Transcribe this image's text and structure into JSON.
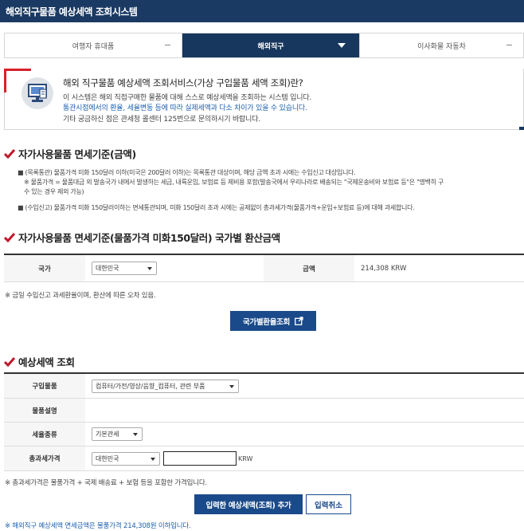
{
  "header": {
    "title": "해외직구물품 예상세액 조회시스템"
  },
  "tabs": [
    {
      "label": "여행자 휴대품"
    },
    {
      "label": "해외직구"
    },
    {
      "label": "이사화물 자동차"
    }
  ],
  "info": {
    "heading": "해외 직구물품 예상세액 조회서비스(가상 구입물품 세액 조회)란?",
    "line1": "이 시스템은 해외 직접구매한 물품에 대해 스스로 예상세액을 조회하는 시스템 입니다.",
    "line2": "통관시점에서의 환율, 세율변동 등에 따라 실제세액과 다소 차이가 있을 수 있습니다.",
    "line3": "기타 궁금하신 점은 관세청 콜센터 125번으로 문의하시기 바랍니다."
  },
  "section1": {
    "title": "자가사용물품 면세기준(금액)",
    "b1": "(목록통관) 물품가격 미화 150달러 이하(미국은 200달러 이하)는 목록통관 대상이며, 해당 금액 초과 시에는 수입신고 대상입니다.",
    "b1_note1": "※ 물품가격 = 물품대금 외 발송국가 내에서 발생하는 세금, 내륙운임, 보험료 등 제비용 포함(발송국에서 우리나라로 배송되는 \"국제운송비와 보험료 등\"은 \"명백히 구",
    "b1_note2": "수 있는 경우 제외 가능)",
    "b2": "(수입신고) 물품가격 미화 150달러이하는 면세통관되며, 미화 150달러 초과 시에는 공제없이 총과세가격(물품가격+운임+보험료 등)에 대해 과세합니다."
  },
  "section2": {
    "title": "자가사용물품 면세기준(물품가격 미화150달러) 국가별 환산금액",
    "country_label": "국가",
    "country_value": "대한민국",
    "amount_label": "금액",
    "amount_value": "214,308 KRW",
    "note": "※ 금일 수입신고 과세환율이며, 환산에 따른 오차 있음.",
    "button": "국가별환율조회"
  },
  "section3": {
    "title": "예상세액 조회",
    "item_label": "구입물품",
    "item_value": "컴퓨터/가전/영상/음향_컴퓨터, 관련 부품",
    "desc_label": "물품설명",
    "tax_label": "세율종류",
    "tax_value": "기본관세",
    "price_label": "총과세가격",
    "price_country": "대한민국",
    "price_value": "",
    "price_unit": "KRW",
    "note": "※ 총과세가격은 물품가격 + 국제 배송료 + 보험 등을 포함한 가격입니다.",
    "add_button": "입력한 예상세액(조회) 추가",
    "cancel_button": "입력취소",
    "footer_prefix": "※ 해외직구 예상세액 면세금액은 ",
    "footer_amount": "물품가격 214,308",
    "footer_suffix": "원 이하입니다."
  },
  "colors": {
    "navy": "#17375e",
    "red": "#d9202a",
    "blue": "#1b5fb0"
  }
}
